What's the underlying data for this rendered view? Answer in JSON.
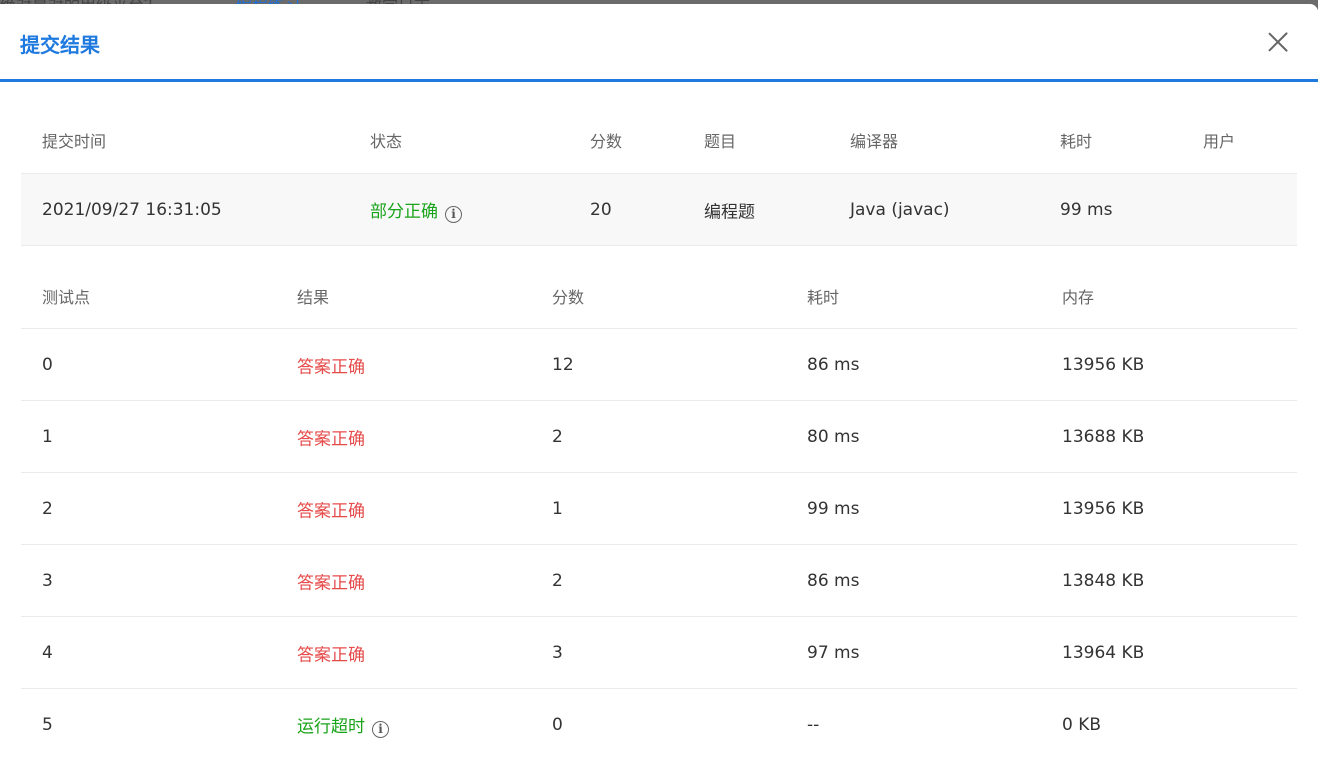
{
  "background_tabs": [
    "绝对是对的甲级平台？",
    "编程练习",
    "教学日志"
  ],
  "modal": {
    "title": "提交结果"
  },
  "summary": {
    "headers": {
      "time": "提交时间",
      "status": "状态",
      "score": "分数",
      "problem": "题目",
      "compiler": "编译器",
      "duration": "耗时",
      "user": "用户"
    },
    "row": {
      "time": "2021/09/27 16:31:05",
      "status": "部分正确",
      "score": "20",
      "problem": "编程题",
      "compiler": "Java (javac)",
      "duration": "99 ms",
      "user": ""
    }
  },
  "testcases": {
    "headers": {
      "id": "测试点",
      "result": "结果",
      "score": "分数",
      "duration": "耗时",
      "memory": "内存"
    },
    "rows": [
      {
        "id": "0",
        "result": "答案正确",
        "score": "12",
        "duration": "86 ms",
        "memory": "13956 KB"
      },
      {
        "id": "1",
        "result": "答案正确",
        "score": "2",
        "duration": "80 ms",
        "memory": "13688 KB"
      },
      {
        "id": "2",
        "result": "答案正确",
        "score": "1",
        "duration": "99 ms",
        "memory": "13956 KB"
      },
      {
        "id": "3",
        "result": "答案正确",
        "score": "2",
        "duration": "86 ms",
        "memory": "13848 KB"
      },
      {
        "id": "4",
        "result": "答案正确",
        "score": "3",
        "duration": "97 ms",
        "memory": "13964 KB"
      },
      {
        "id": "5",
        "result": "运行超时",
        "score": "0",
        "duration": "--",
        "memory": "0 KB"
      }
    ]
  },
  "icons": {
    "close": "close-icon",
    "info": "info-icon"
  },
  "colors": {
    "accent": "#1f7ae0",
    "partial": "#19a319",
    "accepted": "#e64b4b",
    "timeout": "#19a319"
  }
}
